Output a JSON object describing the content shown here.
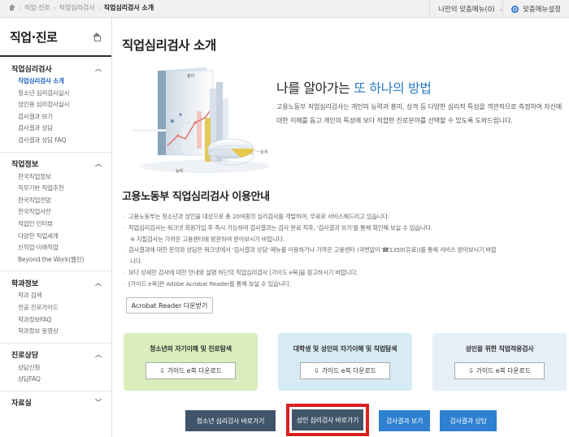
{
  "topbar": {
    "breadcrumbs": [
      "직업·진로",
      "직업심리검사",
      "직업심리검사 소개"
    ],
    "my_menu": "나만의 맞춤메뉴(0)",
    "settings": "맞춤메뉴설정"
  },
  "sidebar": {
    "title": "직업·진로",
    "groups": [
      {
        "title": "직업심리검사",
        "items": [
          "직업심리검사 소개",
          "청소년 심리검사실시",
          "성인용 심리검사실시",
          "검사결과 보기",
          "검사결과 상담",
          "검사결과 상담 FAQ"
        ]
      },
      {
        "title": "직업정보",
        "items": [
          "한국직업정보",
          "직무기반 직업추천",
          "한국직업전망",
          "한국직업사전",
          "직업인 인터뷰",
          "다양한 직업세계",
          "신직업·미래직업",
          "Beyond the Work(웹진)"
        ]
      },
      {
        "title": "학과정보",
        "items": [
          "학과 검색",
          "전공 진로가이드",
          "학과정보FAQ",
          "학과정보 동영상"
        ]
      },
      {
        "title": "진로상담",
        "items": [
          "상담신청",
          "상담FAQ"
        ]
      },
      {
        "title": "자료실",
        "items": []
      }
    ]
  },
  "main": {
    "title": "직업심리검사 소개",
    "illustration": {
      "label_top": "흥미",
      "label_left": "능력",
      "label_right": "성격"
    },
    "headline_pre": "나를 알아가는 ",
    "headline_hl": "또 하나의 방법",
    "intro": "고용노동부 직업심리검사는 개인의 능력과 흥미, 성격 등 다양한 심리적 특성을 객관적으로 측정하여 자신에 대한 이해를 돕고 개인의 특성에 보다 적합한 진로분야를 선택할 수 있도록 도와드립니다.",
    "guide_title": "고용노동부 직업심리검사 이용안내",
    "guide_items": [
      "고용노동부는 청소년과 성인을 대상으로 총 20여종의 심리검사를 개발하여, 무료로 서비스해드리고 있습니다.",
      "직업심리검사는 워크넷 회원가입 후 즉시 가능하며 검사결과는 검사 완료 직후, '검사결과 보기'를 통해 확인해 보실 수 있습니다.",
      "※ 지필검사는 가까운 고용센터에 방문하여 받아보시기 바랍니다.",
      "검사결과에 대한 문의와 상담은 워크넷에서 '검사결과 상담' 메뉴를 이용하거나 가까운 고용센터 (국번없이 ☎1350(유료))를 통해 서비스 받아보시기 바랍",
      "니다.",
      "보다 상세한 검사에 대한 안내와 설명 하단의 직업심리검사 [가이드 e북]을 참고하시기 바랍니다.",
      "[가이드 e북]은 Adobe Acrobat Reader를 통해 보실 수 있습니다."
    ],
    "acrobat_btn": "Acrobat Reader 다운받기",
    "cards": [
      {
        "title": "청소년의 자기이해 및 진로탐색",
        "btn": "가이드 e북 다운로드"
      },
      {
        "title": "대학생 및 성인의 자기이해 및 직업탐색",
        "btn": "가이드 e북 다운로드"
      },
      {
        "title": "성인을 위한 직업적응검사",
        "btn": "가이드 e북 다운로드"
      }
    ],
    "bottom_buttons": [
      "청소년 심리검사 바로가기",
      "성인 심리검사 바로가기",
      "검사결과 보기",
      "검사결과 상담"
    ],
    "colors": {
      "accent": "#2a7ac7",
      "highlight_border": "#d9201f",
      "dark_button": "#41556a",
      "blue_button": "#2f80d1"
    }
  }
}
